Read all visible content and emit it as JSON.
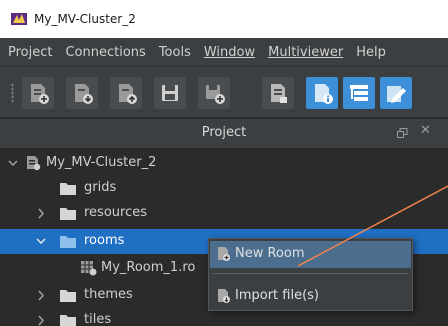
{
  "window": {
    "title": "My_MV-Cluster_2"
  },
  "menubar": {
    "items": [
      {
        "label": "Project"
      },
      {
        "label": "Connections"
      },
      {
        "label": "Tools"
      },
      {
        "label": "Window"
      },
      {
        "label": "Multiviewer"
      },
      {
        "label": "Help"
      }
    ]
  },
  "panel": {
    "title": "Project"
  },
  "tree": {
    "root": {
      "label": "My_MV-Cluster_2"
    },
    "items": [
      {
        "label": "grids"
      },
      {
        "label": "resources"
      },
      {
        "label": "rooms"
      },
      {
        "label": "My_Room_1.ro"
      },
      {
        "label": "themes"
      },
      {
        "label": "tiles"
      }
    ]
  },
  "context_menu": {
    "items": [
      {
        "label": "New Room"
      },
      {
        "label": "Import file(s)"
      }
    ]
  },
  "colors": {
    "selection": "#1f6fc3",
    "menu_hover": "#4b6e8f",
    "accent_button": "#3d8fd8",
    "annotation_line": "#f0834d"
  }
}
